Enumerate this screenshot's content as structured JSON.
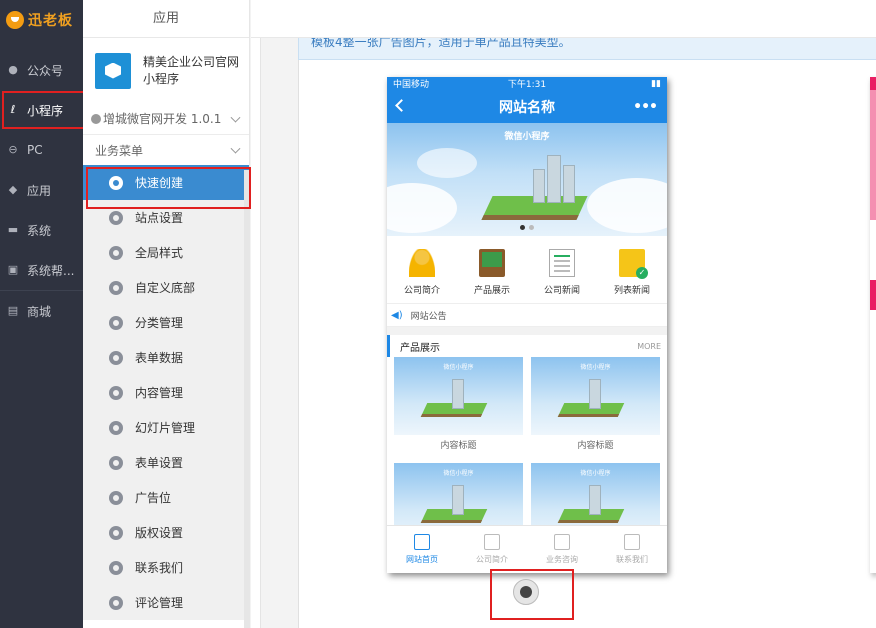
{
  "brand": {
    "logo_text": "迅老板"
  },
  "nav": {
    "items": [
      {
        "label": "公众号",
        "icon": "user-icon"
      },
      {
        "label": "小程序",
        "icon": "mini-program-icon",
        "active": true
      },
      {
        "label": "PC",
        "icon": "pc-icon"
      },
      {
        "label": "应用",
        "icon": "box-icon"
      },
      {
        "label": "系统",
        "icon": "monitor-icon"
      },
      {
        "label": "系统帮...",
        "icon": "help-icon"
      },
      {
        "label": "商城",
        "icon": "store-icon"
      }
    ]
  },
  "column2": {
    "header": "应用",
    "app_name": "精美企业公司官网小程序",
    "version": "增城微官网开发 1.0.1",
    "section": "业务菜单",
    "menu": [
      {
        "label": "快速创建",
        "active": true
      },
      {
        "label": "站点设置"
      },
      {
        "label": "全局样式"
      },
      {
        "label": "自定义底部"
      },
      {
        "label": "分类管理"
      },
      {
        "label": "表单数据"
      },
      {
        "label": "内容管理"
      },
      {
        "label": "幻灯片管理"
      },
      {
        "label": "表单设置"
      },
      {
        "label": "广告位"
      },
      {
        "label": "版权设置"
      },
      {
        "label": "联系我们"
      },
      {
        "label": "评论管理"
      }
    ]
  },
  "notice": {
    "text": "模板4整一张广告图片，适用于单产品且特美型。"
  },
  "phone": {
    "status": {
      "carrier": "中国移动",
      "time": "下午1:31"
    },
    "nav_title": "网站名称",
    "banner_caption": "微信小程序",
    "quick": [
      {
        "label": "公司简介",
        "icon": "person-icon"
      },
      {
        "label": "产品展示",
        "icon": "board-icon"
      },
      {
        "label": "公司新闻",
        "icon": "news-icon"
      },
      {
        "label": "列表新闻",
        "icon": "folder-check-icon"
      }
    ],
    "announcement": "网站公告",
    "section_title": "产品展示",
    "section_more": "MORE",
    "card_caption": "微信小程序",
    "products": [
      {
        "label": "内容标题"
      },
      {
        "label": "内容标题"
      },
      {
        "label": ""
      },
      {
        "label": ""
      }
    ],
    "tabs": [
      {
        "label": "网站首页",
        "active": true
      },
      {
        "label": "公司简介"
      },
      {
        "label": "业务咨询"
      },
      {
        "label": "联系我们"
      }
    ]
  },
  "colors": {
    "nav_bg": "#2f3340",
    "accent": "#1e88e5",
    "menu_active": "#3a8bd0",
    "highlight": "#e02020"
  }
}
